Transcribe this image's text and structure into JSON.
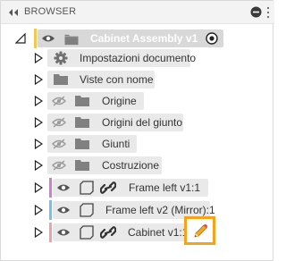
{
  "header": {
    "title": "BROWSER",
    "collapse_icon": "double-chevron-left-icon",
    "minimize_icon": "minus-circle-icon"
  },
  "root": {
    "label": "Cabinet Assembly v1",
    "expand_state": "expanded",
    "accent": "#f2c94c"
  },
  "items": [
    {
      "label": "Impostazioni documento",
      "icon": "gear-icon"
    },
    {
      "label": "Viste con nome",
      "icon": "folder-icon"
    },
    {
      "label": "Origine",
      "icon": "folder-icon",
      "visibility": "hidden"
    },
    {
      "label": "Origini del giunto",
      "icon": "folder-icon",
      "visibility": "hidden"
    },
    {
      "label": "Giunti",
      "icon": "folder-icon",
      "visibility": "hidden"
    },
    {
      "label": "Costruzione",
      "icon": "folder-icon",
      "visibility": "hidden"
    },
    {
      "label": "Frame left v1:1",
      "icon": "component-link-icon",
      "visibility": "visible",
      "accent": "#d17bd8"
    },
    {
      "label": "Frame left v2 (Mirror):1",
      "icon": "component-icon",
      "visibility": "visible",
      "accent": "#6fc3f0"
    },
    {
      "label": "Cabinet v1:1",
      "icon": "component-link-icon",
      "visibility": "visible",
      "accent": "#f0a0a8",
      "action_icon": "pencil-edit-icon"
    }
  ],
  "colors": {
    "highlight_border": "#f7a21b",
    "row_bg": "#e9e9e9",
    "root_bg": "#d8d8d8"
  }
}
